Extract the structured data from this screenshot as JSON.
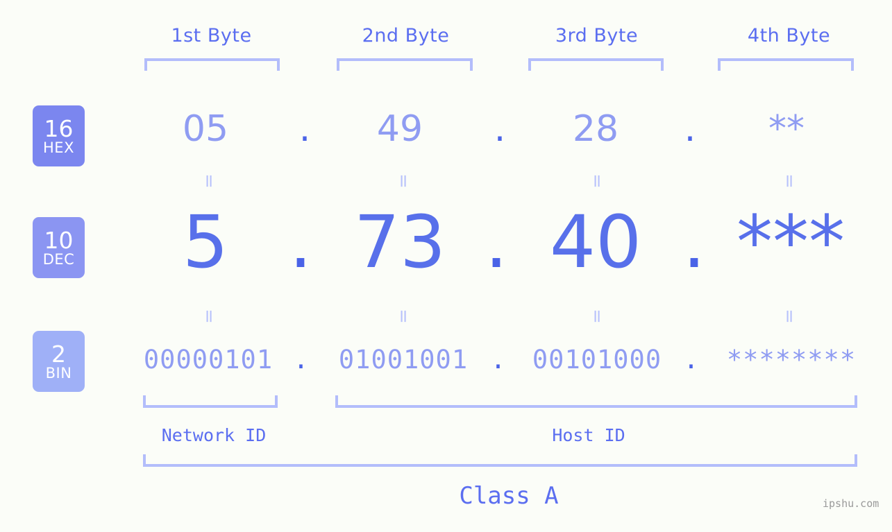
{
  "background_color": "#fbfdf8",
  "accent_color": "#5b6ef0",
  "bracket_color": "#b3bdfb",
  "byte_headers": [
    {
      "label": "1st Byte"
    },
    {
      "label": "2nd Byte"
    },
    {
      "label": "3rd Byte"
    },
    {
      "label": "4th Byte"
    }
  ],
  "rows": [
    {
      "badge_number": "16",
      "badge_name": "HEX",
      "badge_color": "#7b86ef",
      "values": [
        "05",
        "49",
        "28",
        "**"
      ],
      "separator": "."
    },
    {
      "badge_number": "10",
      "badge_name": "DEC",
      "badge_color": "#8b95f2",
      "values": [
        "5",
        "73",
        "40",
        "***"
      ],
      "separator": "."
    },
    {
      "badge_number": "2",
      "badge_name": "BIN",
      "badge_color": "#9fb0f7",
      "values": [
        "00000101",
        "01001001",
        "00101000",
        "********"
      ],
      "separator": "."
    }
  ],
  "equals_marks": [
    "=",
    "=",
    "=",
    "=",
    "=",
    "=",
    "=",
    "="
  ],
  "id_sections": [
    {
      "label": "Network ID"
    },
    {
      "label": "Host ID"
    }
  ],
  "class_label": "Class A",
  "watermark": "ipshu.com"
}
